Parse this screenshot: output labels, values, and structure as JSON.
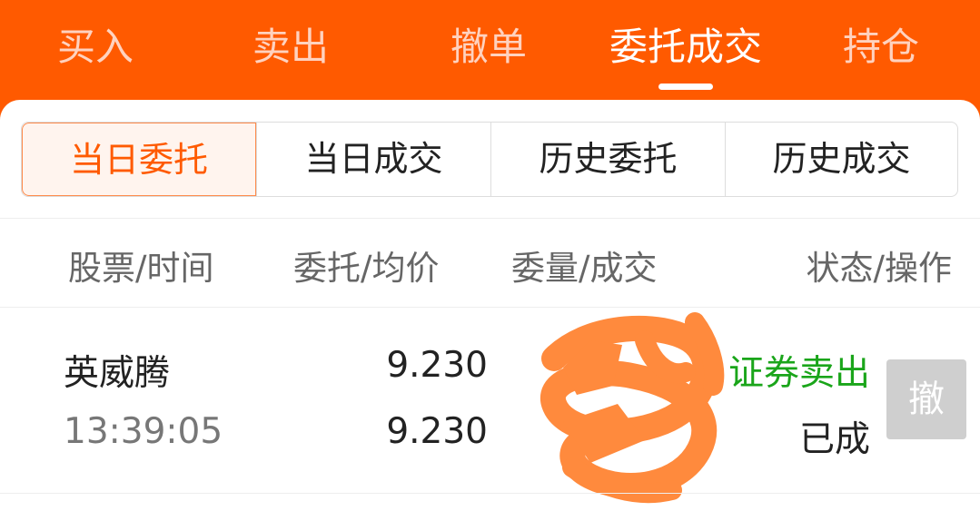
{
  "top_tabs": [
    {
      "label": "买入"
    },
    {
      "label": "卖出"
    },
    {
      "label": "撤单"
    },
    {
      "label": "委托成交"
    },
    {
      "label": "持仓"
    }
  ],
  "segments": [
    {
      "label": "当日委托"
    },
    {
      "label": "当日成交"
    },
    {
      "label": "历史委托"
    },
    {
      "label": "历史成交"
    }
  ],
  "columns": [
    "股票/时间",
    "委托/均价",
    "委量/成交",
    "状态/操作"
  ],
  "rows": [
    {
      "stock": "英威腾",
      "time": "13:39:05",
      "order_price": "9.230",
      "avg_price": "9.230",
      "order_qty": "",
      "deal_qty": "",
      "type": "证券卖出",
      "status": "已成",
      "cancel_label": "撤"
    }
  ],
  "colors": {
    "brand": "#ff5a00",
    "sell_type": "#1aa51a",
    "redaction": "#ff8a3d"
  }
}
